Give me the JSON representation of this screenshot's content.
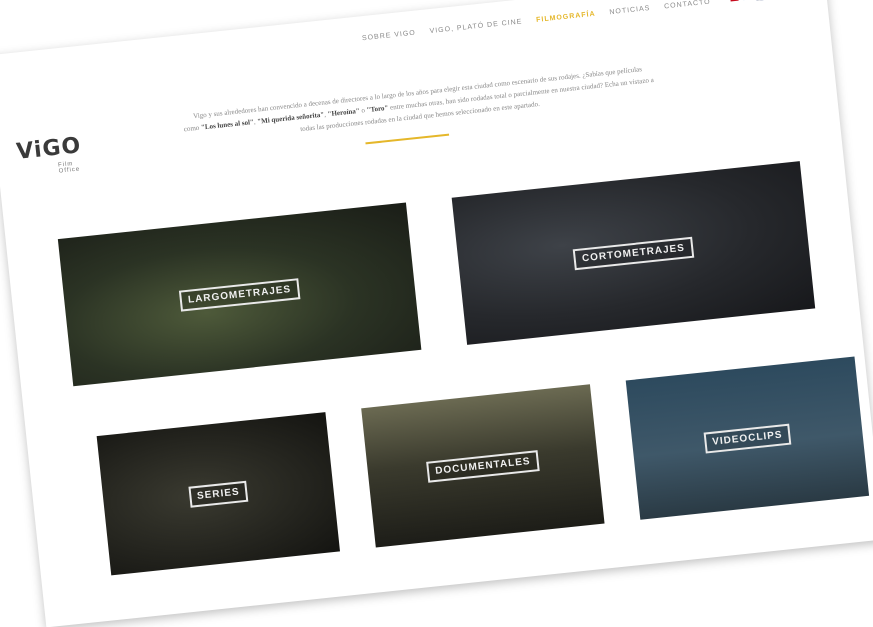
{
  "logo": {
    "word": "ViGO",
    "sub": "Film Office"
  },
  "nav": {
    "items": [
      "SOBRE VIGO",
      "VIGO, PLATÓ DE CINE",
      "FILMOGRAFÍA",
      "NOTICIAS",
      "CONTACTO"
    ],
    "active_index": 2
  },
  "languages": [
    "es",
    "gl",
    "en"
  ],
  "intro": {
    "line1": "Vigo y sus alrededores han convencido a decenas de directores a lo largo de los años para elegir esta ciudad como escenario de sus rodajes. ¿Sabías que películas",
    "line2_pre": "como ",
    "film1": "\"Los lunes al sol\"",
    "sep1": ", ",
    "film2": "\"Mi querida señorita\"",
    "sep2": ", ",
    "film3": "\"Heroína\"",
    "sep3": " o ",
    "film4": "\"Toro\"",
    "line2_post": " entre muchas otras, han sido rodadas total o parcialmente en nuestra ciudad? Echa un vistazo a",
    "line3": "todas las producciones rodadas en la ciudad que hemos seleccionado en este apartado."
  },
  "cards": {
    "largometrajes": "LARGOMETRAJES",
    "cortometrajes": "CORTOMETRAJES",
    "series": "SERIES",
    "documentales": "DOCUMENTALES",
    "videoclips": "VIDEOCLIPS"
  }
}
